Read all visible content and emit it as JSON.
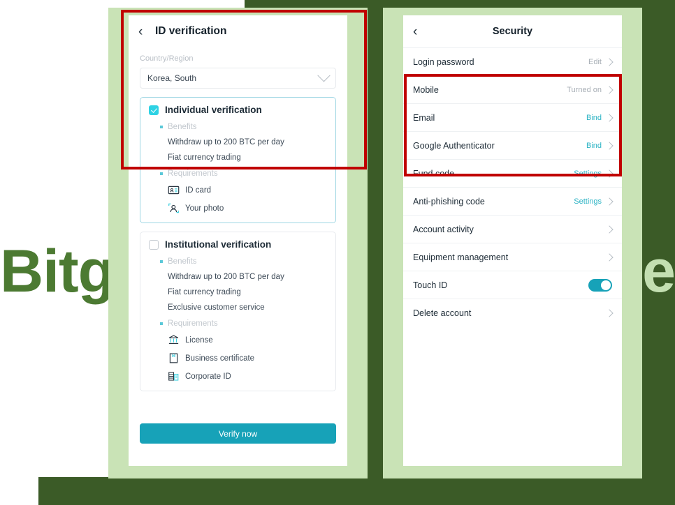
{
  "watermark": {
    "left_text": "Bitg",
    "right_text": "e"
  },
  "left_screen": {
    "nav": {
      "back_icon": "chevron-left-icon",
      "title": "ID verification"
    },
    "country_field": {
      "label": "Country/Region",
      "value": "Korea, South",
      "chevron_icon": "chevron-down-icon"
    },
    "options": [
      {
        "title": "Individual verification",
        "checked": true,
        "benefits_label": "Benefits",
        "benefits": [
          "Withdraw up to 200 BTC per day",
          "Fiat currency trading"
        ],
        "requirements_label": "Requirements",
        "requirements": [
          {
            "label": "ID card",
            "icon": "id-card-icon"
          },
          {
            "label": "Your photo",
            "icon": "portrait-photo-icon"
          }
        ]
      },
      {
        "title": "Institutional verification",
        "checked": false,
        "benefits_label": "Benefits",
        "benefits": [
          "Withdraw up to 200 BTC per day",
          "Fiat currency trading",
          "Exclusive customer service"
        ],
        "requirements_label": "Requirements",
        "requirements": [
          {
            "label": "License",
            "icon": "bank-license-icon"
          },
          {
            "label": "Business certificate",
            "icon": "certificate-icon"
          },
          {
            "label": "Corporate ID",
            "icon": "corporate-id-icon"
          }
        ]
      }
    ],
    "submit_label": "Verify now"
  },
  "right_screen": {
    "nav": {
      "back_icon": "chevron-left-icon",
      "title": "Security"
    },
    "rows": [
      {
        "label": "Login password",
        "value": "Edit",
        "value_style": "muted",
        "control": "chevron"
      },
      {
        "label": "Mobile",
        "value": "Turned on",
        "value_style": "muted",
        "control": "chevron"
      },
      {
        "label": "Email",
        "value": "Bind",
        "value_style": "link",
        "control": "chevron"
      },
      {
        "label": "Google Authenticator",
        "value": "Bind",
        "value_style": "link",
        "control": "chevron"
      },
      {
        "label": "Fund code",
        "value": "Settings",
        "value_style": "link",
        "control": "chevron"
      },
      {
        "label": "Anti-phishing code",
        "value": "Settings",
        "value_style": "link",
        "control": "chevron"
      },
      {
        "label": "Account activity",
        "value": "",
        "value_style": "muted",
        "control": "chevron"
      },
      {
        "label": "Equipment management",
        "value": "",
        "value_style": "muted",
        "control": "chevron"
      },
      {
        "label": "Touch ID",
        "value": "",
        "value_style": "muted",
        "control": "toggle-on"
      },
      {
        "label": "Delete account",
        "value": "",
        "value_style": "muted",
        "control": "chevron"
      }
    ]
  },
  "colors": {
    "accent_teal": "#17a2b8",
    "checkbox_cyan": "#2ed2e4",
    "annotation_red": "#c00000",
    "mat_green": "#c9e3b6",
    "dark_green": "#3b5b27",
    "watermark_green": "#4c7a32"
  }
}
